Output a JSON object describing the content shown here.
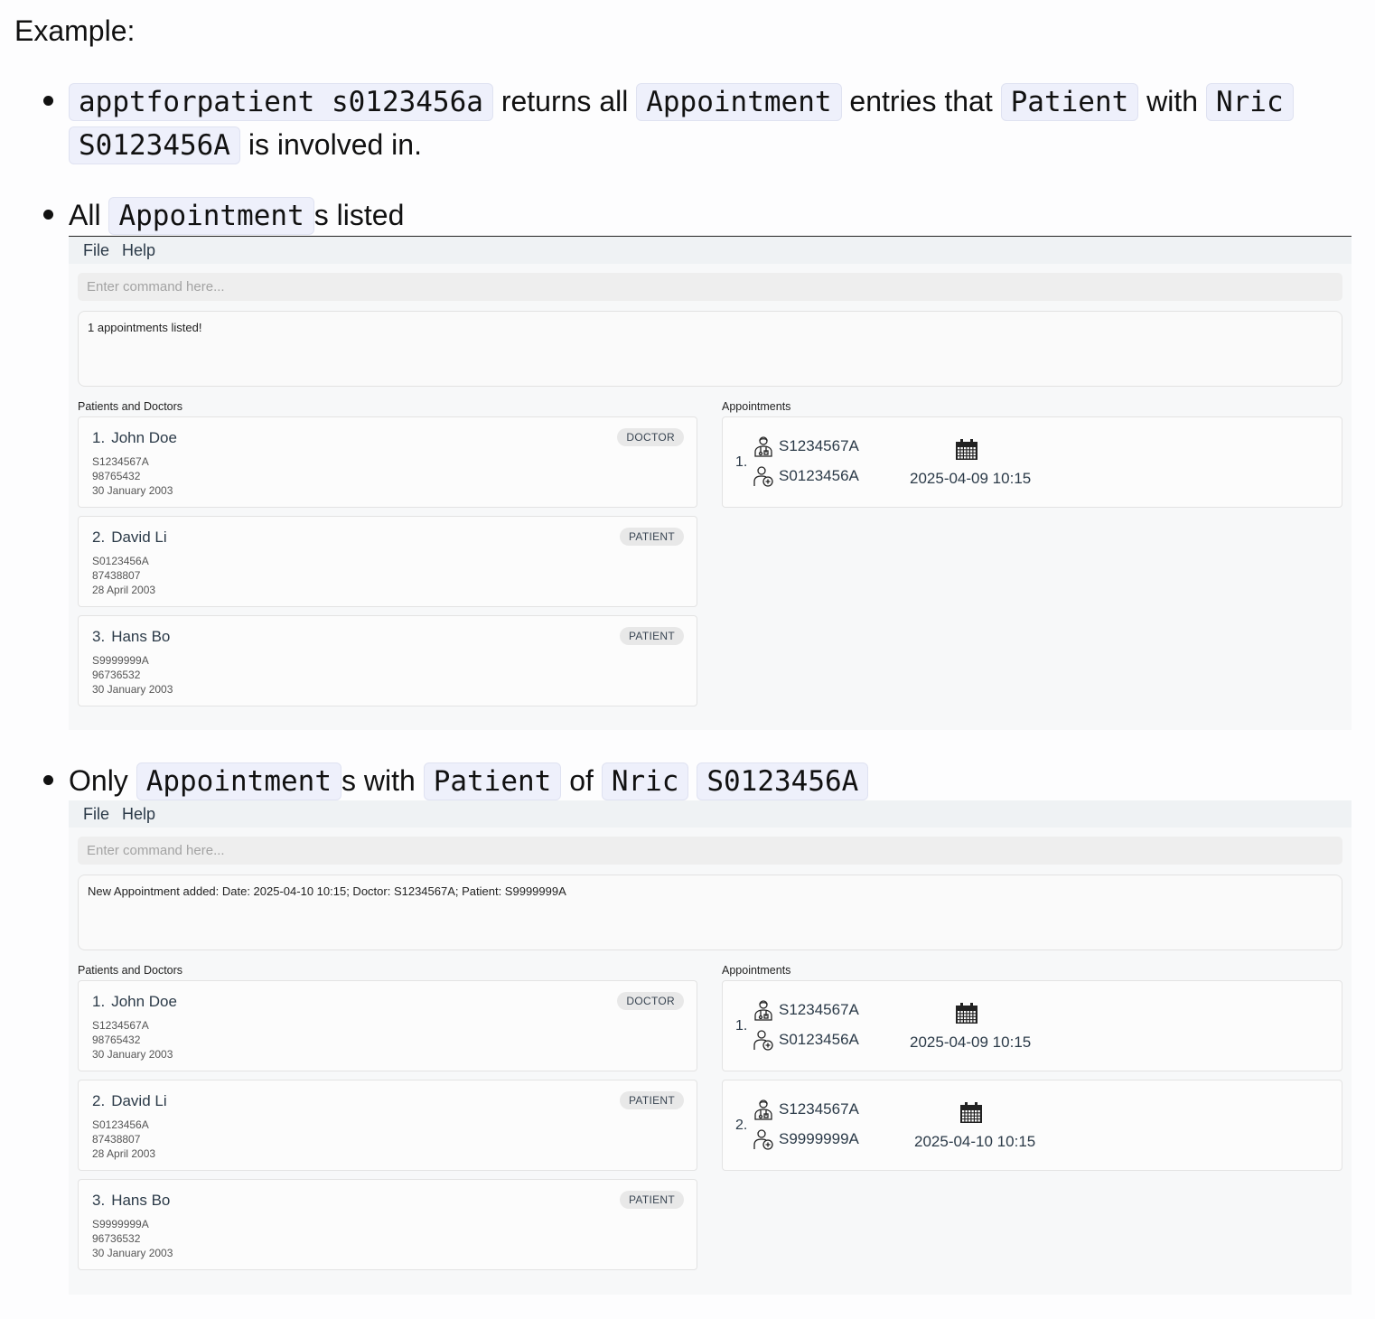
{
  "intro": "Example:",
  "bullet1": {
    "code1": "apptforpatient s0123456a",
    "t1": "returns all",
    "code2": "Appointment",
    "t2": "entries that",
    "code3": "Patient",
    "t3": "with",
    "code4": "Nric",
    "code5": "S0123456A",
    "t4": "is involved in."
  },
  "bullet2": {
    "t1": "All",
    "code1": "Appointment",
    "t2": "s listed"
  },
  "bullet3": {
    "t1": "Only",
    "code1": "Appointment",
    "t2": "s with",
    "code2": "Patient",
    "t3": "of",
    "code3": "Nric",
    "code4": "S0123456A"
  },
  "shot1": {
    "menu": [
      "File",
      "Help"
    ],
    "command_placeholder": "Enter command here...",
    "result": "1 appointments listed!",
    "persons_label": "Patients and Doctors",
    "appts_label": "Appointments",
    "persons": [
      {
        "idx": "1.",
        "name": "John Doe",
        "nric": "S1234567A",
        "phone": "98765432",
        "dob": "30 January 2003",
        "role": "DOCTOR"
      },
      {
        "idx": "2.",
        "name": "David Li",
        "nric": "S0123456A",
        "phone": "87438807",
        "dob": "28 April 2003",
        "role": "PATIENT"
      },
      {
        "idx": "3.",
        "name": "Hans Bo",
        "nric": "S9999999A",
        "phone": "96736532",
        "dob": "30 January 2003",
        "role": "PATIENT"
      }
    ],
    "appointments": [
      {
        "idx": "1.",
        "doctor": "S1234567A",
        "patient": "S0123456A",
        "datetime": "2025-04-09 10:15"
      }
    ]
  },
  "shot2": {
    "menu": [
      "File",
      "Help"
    ],
    "command_placeholder": "Enter command here...",
    "result": "New Appointment added: Date: 2025-04-10 10:15; Doctor: S1234567A; Patient: S9999999A",
    "persons_label": "Patients and Doctors",
    "appts_label": "Appointments",
    "persons": [
      {
        "idx": "1.",
        "name": "John Doe",
        "nric": "S1234567A",
        "phone": "98765432",
        "dob": "30 January 2003",
        "role": "DOCTOR"
      },
      {
        "idx": "2.",
        "name": "David Li",
        "nric": "S0123456A",
        "phone": "87438807",
        "dob": "28 April 2003",
        "role": "PATIENT"
      },
      {
        "idx": "3.",
        "name": "Hans Bo",
        "nric": "S9999999A",
        "phone": "96736532",
        "dob": "30 January 2003",
        "role": "PATIENT"
      }
    ],
    "appointments": [
      {
        "idx": "1.",
        "doctor": "S1234567A",
        "patient": "S0123456A",
        "datetime": "2025-04-09 10:15"
      },
      {
        "idx": "2.",
        "doctor": "S1234567A",
        "patient": "S9999999A",
        "datetime": "2025-04-10 10:15"
      }
    ]
  }
}
